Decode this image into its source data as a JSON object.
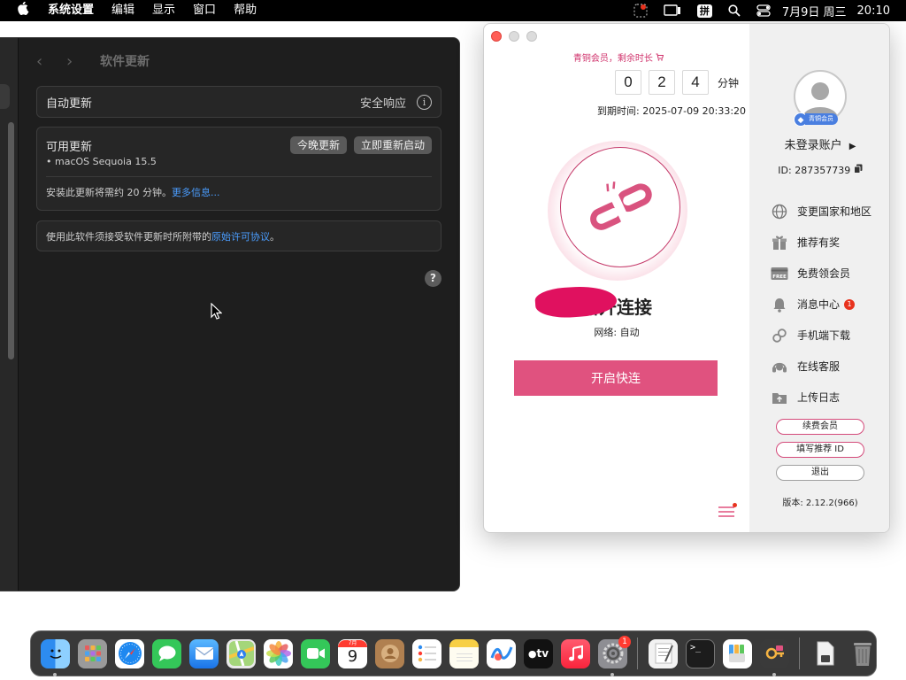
{
  "menubar": {
    "app": "系统设置",
    "items": [
      "编辑",
      "显示",
      "窗口",
      "帮助"
    ],
    "ime": "拼",
    "date": "7月9日 周三",
    "time": "20:10"
  },
  "settings": {
    "title": "软件更新",
    "auto_update": {
      "label": "自动更新",
      "right_label": "安全响应"
    },
    "available": {
      "label": "可用更新",
      "tonight_button": "今晚更新",
      "restart_button": "立即重新启动",
      "version": "• macOS Sequoia 15.5",
      "duration_note": "安装此更新将需约 20 分钟。",
      "more_info": "更多信息..."
    },
    "license": {
      "prefix": "使用此软件须接受软件更新时所附带的",
      "link": "原始许可协议",
      "suffix": "。"
    },
    "help": "?"
  },
  "vpn": {
    "member_tip": "青铜会员，剩余时长",
    "timer_digits": [
      "0",
      "2",
      "4"
    ],
    "timer_unit": "分钟",
    "expiry": "到期时间: 2025-07-09 20:33:20",
    "status": "断开连接",
    "network": "网络:  自动",
    "connect_button": "开启快连",
    "sidebar": {
      "badge": "青铜会员",
      "account": "未登录账户",
      "id": "ID: 287357739",
      "menu": [
        {
          "label": "变更国家和地区",
          "icon": "globe-icon"
        },
        {
          "label": "推荐有奖",
          "icon": "gift-icon"
        },
        {
          "label": "免费领会员",
          "icon": "free-icon"
        },
        {
          "label": "消息中心",
          "icon": "bell-icon",
          "badge": "1"
        },
        {
          "label": "手机端下载",
          "icon": "link-icon"
        },
        {
          "label": "在线客服",
          "icon": "headset-icon"
        },
        {
          "label": "上传日志",
          "icon": "upload-icon"
        }
      ],
      "renew_button": "续费会员",
      "referral_button": "填写推荐 ID",
      "logout_button": "退出",
      "version": "版本:  2.12.2(966)"
    }
  },
  "dock": {
    "calendar_month": "7月",
    "calendar_day": "9",
    "tv_label": "tv",
    "settings_badge": "1"
  },
  "colors": {
    "accent_pink": "#e0527f",
    "link_blue": "#4a9dff",
    "settings_bg": "#1e1e1e"
  }
}
